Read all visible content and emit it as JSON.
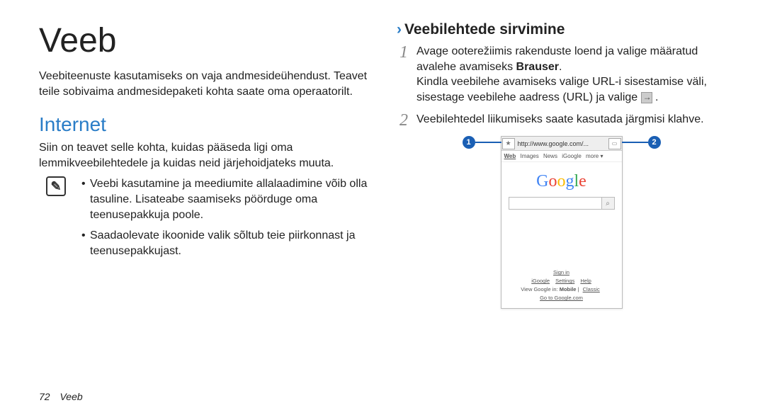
{
  "page_title": "Veeb",
  "intro": "Veebiteenuste kasutamiseks on vaja andmesideühendust. Teavet teile sobivaima andmesidepaketi kohta saate oma operaatorilt.",
  "section": {
    "title": "Internet",
    "desc": "Siin on teavet selle kohta, kuidas pääseda ligi oma lemmikveebilehtedele ja kuidas neid järjehoidjateks muuta."
  },
  "notes": [
    "Veebi kasutamine ja meediumite allalaadimine võib olla tasuline. Lisateabe saamiseks pöörduge oma teenusepakkuja poole.",
    "Saadaolevate ikoonide valik sõltub teie piirkonnast ja teenusepakkujast."
  ],
  "subsection_title": "Veebilehtede sirvimine",
  "steps": [
    {
      "num": "1",
      "text_a": "Avage ooterežiimis rakenduste loend ja valige määratud avalehe avamiseks ",
      "bold": "Brauser",
      "text_b": ".",
      "text_c": "Kindla veebilehe avamiseks valige URL-i sisestamise väli, sisestage veebilehe aadress (URL) ja valige "
    },
    {
      "num": "2",
      "text_a": "Veebilehtedel liikumiseks saate kasutada järgmisi klahve."
    }
  ],
  "browser": {
    "url": "http://www.google.com/...",
    "nav": {
      "web": "Web",
      "images": "Images",
      "news": "News",
      "igoogle": "iGoogle",
      "more": "more ▾"
    },
    "logo_letters": [
      "G",
      "o",
      "o",
      "g",
      "l",
      "e"
    ],
    "footer_signin": "Sign in",
    "footer_links": [
      "iGoogle",
      "Settings",
      "Help"
    ],
    "footer_view": "View Google in: ",
    "footer_mobile": "Mobile",
    "footer_classic": "Classic",
    "footer_goto": "Go to Google.com"
  },
  "callouts": {
    "c1": "1",
    "c2": "2"
  },
  "footer": {
    "page": "72",
    "label": "Veeb"
  }
}
